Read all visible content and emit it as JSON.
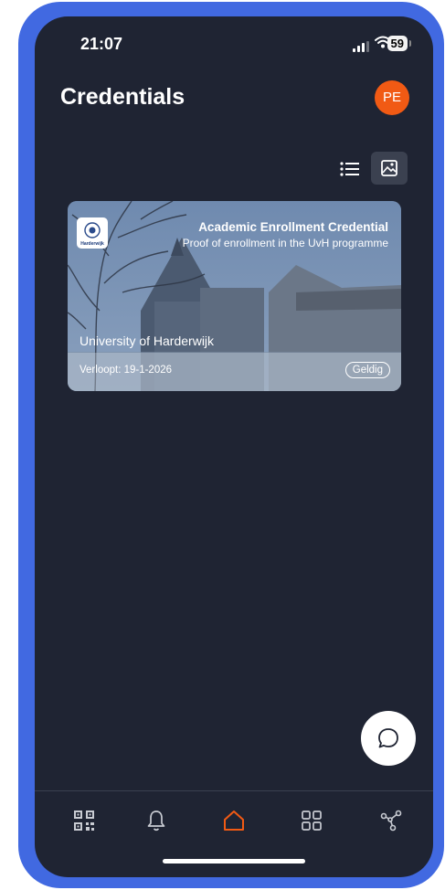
{
  "status_bar": {
    "time": "21:07",
    "battery": "59"
  },
  "header": {
    "title": "Credentials",
    "avatar_initials": "PE"
  },
  "view_toggle": {
    "list_icon": "list-icon",
    "card_icon": "image-gallery-icon",
    "active": "card"
  },
  "credentials": [
    {
      "title": "Academic Enrollment Credential",
      "subtitle": "Proof of enrollment in the UvH programme",
      "issuer": "University of Harderwijk",
      "logo_text": "Harderwijk",
      "expiry": "Verloopt: 19-1-2026",
      "status": "Geldig"
    }
  ],
  "nav": {
    "items": [
      "qr-code-icon",
      "bell-icon",
      "home-icon",
      "grid-icon",
      "share-icon"
    ],
    "active": "home-icon"
  },
  "colors": {
    "background": "#1f2433",
    "accent": "#f15a14",
    "frame": "#4169e1"
  }
}
